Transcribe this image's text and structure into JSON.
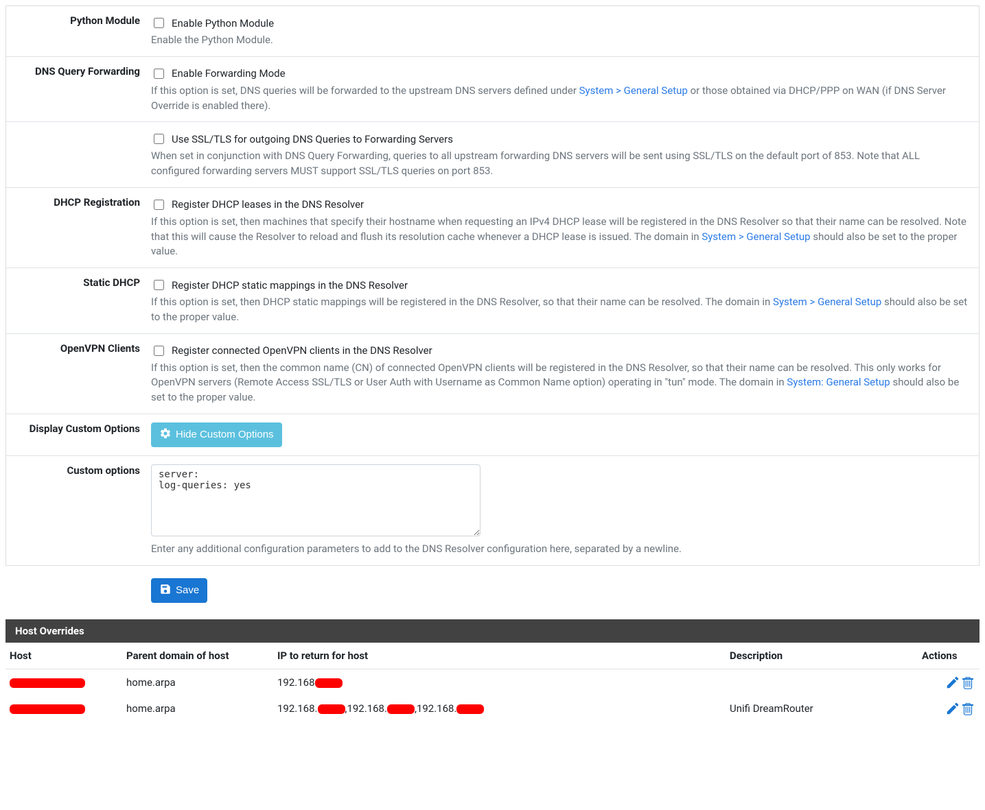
{
  "rows": {
    "python": {
      "label": "Python Module",
      "checkbox_label": "Enable Python Module",
      "help": "Enable the Python Module."
    },
    "forwarding": {
      "label": "DNS Query Forwarding",
      "checkbox_label": "Enable Forwarding Mode",
      "help_pre": "If this option is set, DNS queries will be forwarded to the upstream DNS servers defined under ",
      "help_link": "System > General Setup",
      "help_post": " or those obtained via DHCP/PPP on WAN (if DNS Server Override is enabled there)."
    },
    "forwarding_ssl": {
      "checkbox_label": "Use SSL/TLS for outgoing DNS Queries to Forwarding Servers",
      "help": "When set in conjunction with DNS Query Forwarding, queries to all upstream forwarding DNS servers will be sent using SSL/TLS on the default port of 853. Note that ALL configured forwarding servers MUST support SSL/TLS queries on port 853."
    },
    "dhcp_reg": {
      "label": "DHCP Registration",
      "checkbox_label": "Register DHCP leases in the DNS Resolver",
      "help_pre": "If this option is set, then machines that specify their hostname when requesting an IPv4 DHCP lease will be registered in the DNS Resolver so that their name can be resolved. Note that this will cause the Resolver to reload and flush its resolution cache whenever a DHCP lease is issued. The domain in ",
      "help_link": "System > General Setup",
      "help_post": " should also be set to the proper value."
    },
    "static_dhcp": {
      "label": "Static DHCP",
      "checkbox_label": "Register DHCP static mappings in the DNS Resolver",
      "help_pre": "If this option is set, then DHCP static mappings will be registered in the DNS Resolver, so that their name can be resolved. The domain in ",
      "help_link": "System > General Setup",
      "help_post": " should also be set to the proper value."
    },
    "openvpn": {
      "label": "OpenVPN Clients",
      "checkbox_label": "Register connected OpenVPN clients in the DNS Resolver",
      "help_pre": "If this option is set, then the common name (CN) of connected OpenVPN clients will be registered in the DNS Resolver, so that their name can be resolved. This only works for OpenVPN servers (Remote Access SSL/TLS or User Auth with Username as Common Name option) operating in \"tun\" mode. The domain in ",
      "help_link": "System: General Setup",
      "help_post": " should also be set to the proper value."
    },
    "display_custom": {
      "label": "Display Custom Options",
      "button_label": "Hide Custom Options"
    },
    "custom_options": {
      "label": "Custom options",
      "value": "server:\nlog-queries: yes",
      "help": "Enter any additional configuration parameters to add to the DNS Resolver configuration here, separated by a newline."
    }
  },
  "save_label": "Save",
  "host_overrides": {
    "title": "Host Overrides",
    "columns": {
      "host": "Host",
      "parent": "Parent domain of host",
      "ip": "IP to return for host",
      "description": "Description",
      "actions": "Actions"
    },
    "rows": [
      {
        "host_redacted": true,
        "parent": "home.arpa",
        "ip_prefix": "192.168",
        "ip_segments": 1,
        "description": ""
      },
      {
        "host_redacted": true,
        "parent": "home.arpa",
        "ip_prefix": "192.168.",
        "ip_segments": 3,
        "description": "Unifi DreamRouter"
      }
    ]
  }
}
